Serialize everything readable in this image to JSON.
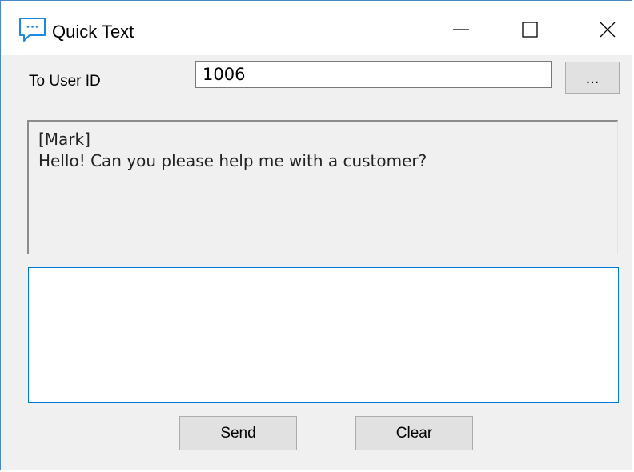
{
  "window": {
    "title": "Quick Text",
    "icon": "chat-bubble-icon",
    "controls": [
      "minimize-icon",
      "maximize-icon",
      "close-icon"
    ]
  },
  "form": {
    "to_user_label": "To User ID",
    "to_user_value": "1006",
    "browse_label": "..."
  },
  "history": {
    "lines": [
      "[Mark]",
      "Hello! Can you please help me with a customer?"
    ]
  },
  "compose": {
    "value": ""
  },
  "buttons": {
    "send": "Send",
    "clear": "Clear"
  },
  "colors": {
    "accent": "#0078d7",
    "window_border": "#4a88c8",
    "background": "#f0f0f0"
  }
}
